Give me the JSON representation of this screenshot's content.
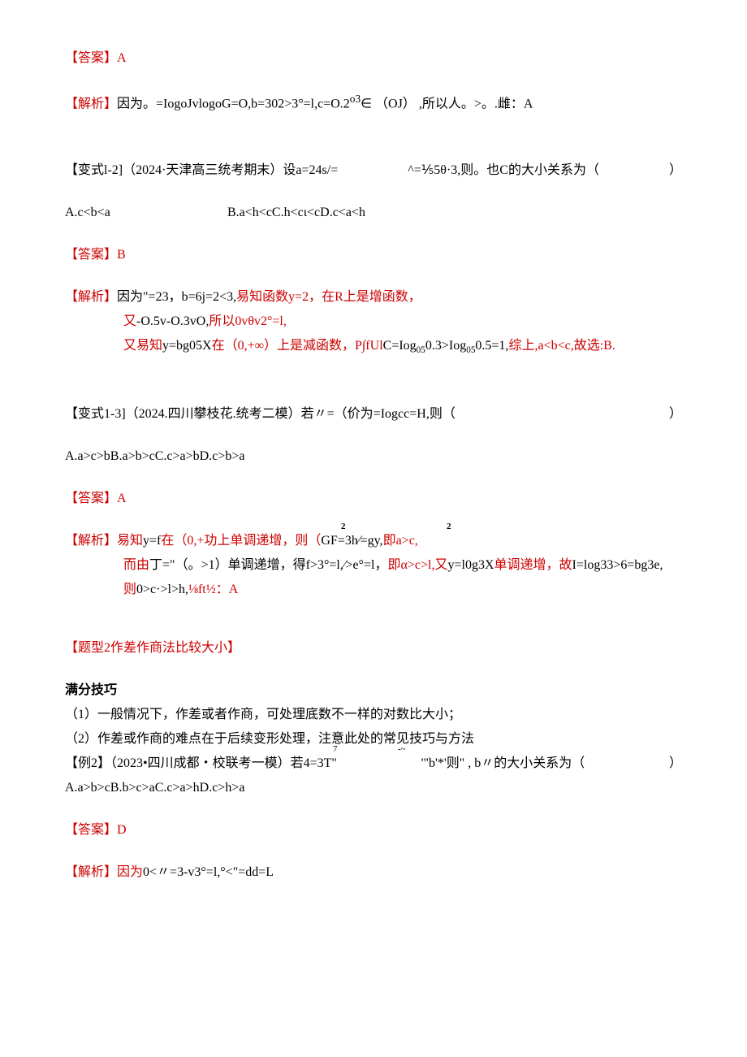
{
  "q1": {
    "answer_label": "【答案】",
    "answer_value": "A",
    "jiexi_label": "【解析】",
    "jiexi_line": "因为。=IogoJvlogoG=O,b=302>3°=l,c=O.2",
    "jiexi_sup": "o3",
    "jiexi_tail": "∈ （OJ） ,所以人。>。.雌：A"
  },
  "q2": {
    "prefix": "【变式l-2]（2024·天津高三统考期末）设a=24s/=",
    "mid": "^=⅕5θ·3,则。也C的大小关系为（",
    "close": "）",
    "optA": "A.c<b<a",
    "optRest": "B.a<h<cC.h<cι<cD.c<a<h",
    "answer_label": "【答案】",
    "answer_value": "B",
    "jiexi_label": "【解析】",
    "jiexi_l1_black": "因为\"=23，b=6j=2<3,",
    "jiexi_l1_red": "易知函数y=2，在R上是增函数，",
    "jiexi_l2_red_a": "又",
    "jiexi_l2_black": "-O.5v-O.3vO,",
    "jiexi_l2_red_b": "所以0vθv2°=l,",
    "jiexi_l3_red_a": "又易知",
    "jiexi_l3_black_a": "y=bg05X",
    "jiexi_l3_red_b": "在（0,+∞）上是减函数，P∫fUl",
    "jiexi_l3_black_b": "C=Iog",
    "jiexi_l3_sub1": "05",
    "jiexi_l3_black_c": "0.3>Iog",
    "jiexi_l3_sub2": "05",
    "jiexi_l3_black_d": "0.5=1,",
    "jiexi_l3_red_c": "综上,a<b<c,故选:B."
  },
  "q3": {
    "prefix": "【变式1-3]（2024.四川攀枝花.统考二模）若〃=（价为=Iogcc=H,则（",
    "close": "）",
    "options": "A.a>c>bB.a>b>cC.c>a>bD.c>b>a",
    "answer_label": "【答案】",
    "answer_value": "A",
    "jiexi_label": "【解析】",
    "sup_a": "2",
    "sup_b": "2",
    "jiexi_l1_red_a": "易知",
    "jiexi_l1_black_a": "y=f",
    "jiexi_l1_red_b": "在（0,+功上单调递增，则（",
    "jiexi_l1_black_b": "GF=3h∕=gy,",
    "jiexi_l1_red_c": "即a>c,",
    "jiexi_l2_red_a": "而由",
    "jiexi_l2_black_a": "丁=\"（。>1）单调递增，得",
    "jiexi_l2_black_b": "f>3°=l,∕>e°=l，",
    "jiexi_l2_red_b": "即α>c>l,",
    "jiexi_l2_red_c": "又",
    "jiexi_l2_black_c": "y=l0g3X",
    "jiexi_l2_red_d": "单调递增，故",
    "jiexi_l2_black_d": "I=log33>6=bg3e,",
    "jiexi_l3_red_a": "则",
    "jiexi_l3_black_a": "0>c·>l>h,",
    "jiexi_l3_red_b": "⅛ft½：A"
  },
  "section": {
    "title": "【题型2作差作商法比较大小】",
    "subtitle": "满分技巧",
    "p1": "（1）一般情况下，作差或者作商，可处理底数不一样的对数比大小；",
    "p2": "（2）作差或作商的难点在于后续变形处理，注意此处的常见技巧与方法"
  },
  "q4": {
    "sup_a": "7",
    "sup_b": "-~",
    "prefix": "【例2】（2023•四川成都・校联考一模）若4=3T\"",
    "mid": "'\"b'*'则\" , b〃的大小关系为（",
    "close": "）",
    "options": "A.a>b>cB.b>c>aC.c>a>hD.c>h>a",
    "answer_label": "【答案】",
    "answer_value": "D",
    "jiexi_label": "【解析】",
    "jiexi_red": "因为",
    "jiexi_black": "0<〃=3-v3°=l,°<\"=dd=L"
  }
}
